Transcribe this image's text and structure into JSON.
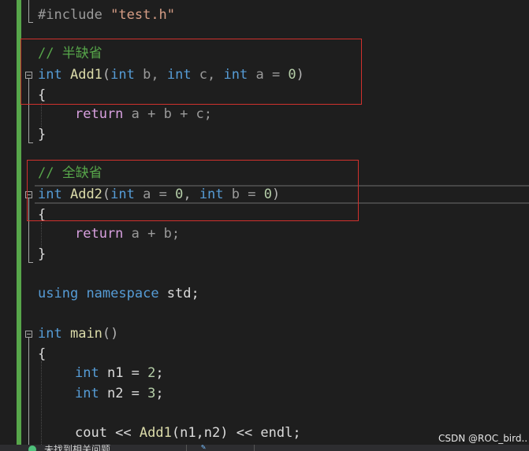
{
  "editor": {
    "colors": {
      "background": "#1e1e1e",
      "keyword": "#569cd6",
      "control_keyword": "#d8a0df",
      "function": "#dcdcaa",
      "comment": "#57a64a",
      "number": "#b5cea8",
      "string": "#d69d85",
      "highlight_box": "#d0312d",
      "change_bar": "#57a64a"
    },
    "code": {
      "l1_directive": "#include",
      "l1_header": "\"test.h\"",
      "l2_comment": "// 半缺省",
      "l3_kw_int": "int",
      "l3_fn": "Add1",
      "l3_open": "(",
      "l3_p1_type": "int",
      "l3_p1_name": " b, ",
      "l3_p2_type": "int",
      "l3_p2_name": " c, ",
      "l3_p3_type": "int",
      "l3_p3_name": " a = ",
      "l3_p3_default": "0",
      "l3_close": ")",
      "l4_brace": "{",
      "l5_return": "return",
      "l5_expr": " a + b + c;",
      "l6_brace": "}",
      "l7_comment": "// 全缺省",
      "l8_kw_int": "int",
      "l8_fn": "Add2",
      "l8_open": "(",
      "l8_p1_type": "int",
      "l8_p1_name": " a = ",
      "l8_p1_default": "0",
      "l8_sep": ", ",
      "l8_p2_type": "int",
      "l8_p2_name": " b = ",
      "l8_p2_default": "0",
      "l8_close": ")",
      "l9_brace": "{",
      "l10_return": "return",
      "l10_expr": " a + b;",
      "l11_brace": "}",
      "l12_using": "using",
      "l12_namespace": "namespace",
      "l12_std": " std;",
      "l13_kw_int": "int",
      "l13_fn": "main",
      "l13_parens": "()",
      "l14_brace": "{",
      "l15_kw_int": "int",
      "l15_rest": " n1 = ",
      "l15_val": "2",
      "l15_semi": ";",
      "l16_kw_int": "int",
      "l16_rest": " n2 = ",
      "l16_val": "3",
      "l16_semi": ";",
      "l17_cout": "cout << ",
      "l17_fn": "Add1",
      "l17_args": "(n1,n2) << endl;"
    }
  },
  "status_bar": {
    "status_text": "未找到相关问题"
  },
  "watermark": "CSDN @ROC_bird.."
}
